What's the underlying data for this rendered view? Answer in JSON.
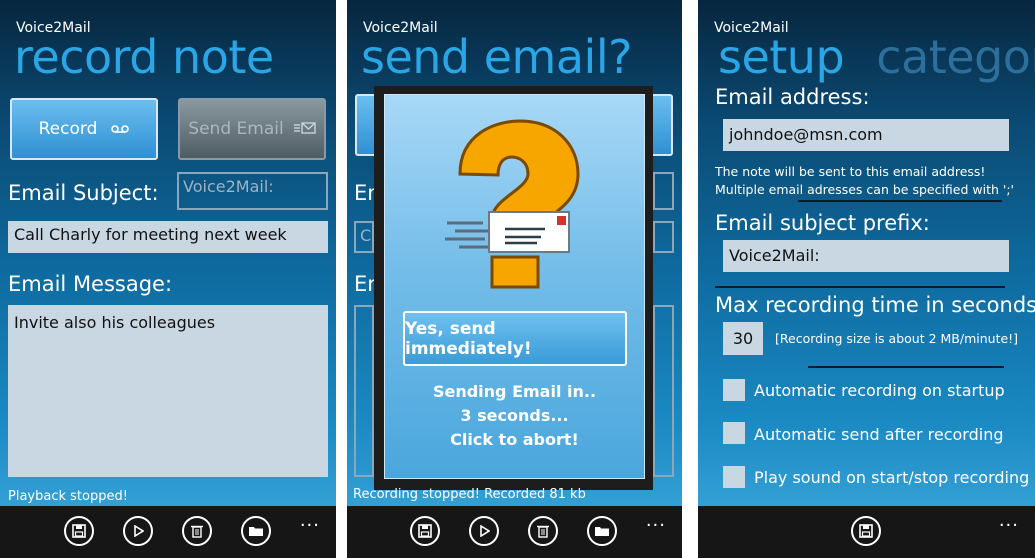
{
  "screens": {
    "record": {
      "app_name": "Voice2Mail",
      "title": "record note",
      "record_button": "Record",
      "send_button": "Send Email",
      "subject_label": "Email Subject:",
      "subject_prefix": "Voice2Mail:",
      "subject_value": "Call Charly for meeting next week",
      "message_label": "Email Message:",
      "message_value": "Invite also his colleagues",
      "status": "Playback stopped!",
      "more": "..."
    },
    "send": {
      "app_name": "Voice2Mail",
      "title": "send email?",
      "bg_label_1": "Em",
      "bg_field": "Ca",
      "bg_label_2": "En",
      "dialog": {
        "button": "Yes, send immediately!",
        "line1": "Sending Email in..",
        "line2": "3 seconds...",
        "line3": "Click to abort!"
      },
      "status": "Recording stopped! Recorded 81 kb",
      "more": "..."
    },
    "setup": {
      "app_name": "Voice2Mail",
      "title": "setup",
      "title_next": "categori",
      "email_label": "Email address:",
      "email_value": "johndoe@msn.com",
      "note_line1": "The note will be sent to this email address!",
      "note_line2": "Multiple email adresses can be specified with ';'",
      "prefix_label": "Email subject prefix:",
      "prefix_value": "Voice2Mail:",
      "max_label": "Max recording time in seconds",
      "max_value": "30",
      "max_hint": "[Recording size is about 2 MB/minute!]",
      "options": [
        "Automatic recording on startup",
        "Automatic send after recording",
        "Play sound on start/stop recording"
      ],
      "more": "..."
    }
  },
  "icons": [
    "voicemail-icon",
    "email-send-icon",
    "save-icon",
    "play-icon",
    "delete-icon",
    "folder-icon",
    "question-mark-icon",
    "envelope-icon"
  ],
  "colors": {
    "accent": "#2aa6e6",
    "button": "#3f9fdc",
    "field": "#c8d7e2",
    "appbar": "#161616"
  }
}
